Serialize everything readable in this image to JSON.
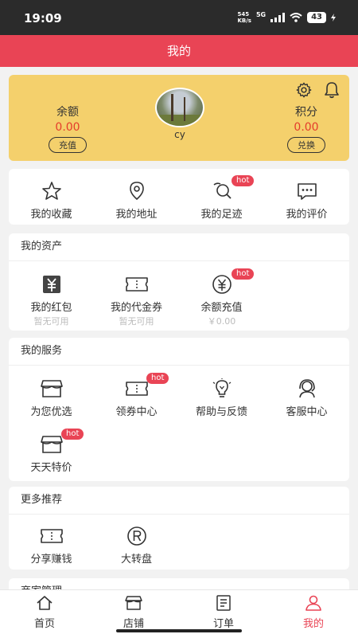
{
  "status": {
    "time": "19:09",
    "speed_top": "545",
    "speed_bottom": "KB/s",
    "network": "5G",
    "battery": "43"
  },
  "header": {
    "title": "我的"
  },
  "profile": {
    "balance_label": "余额",
    "balance_value": "0.00",
    "recharge_button": "充值",
    "points_label": "积分",
    "points_value": "0.00",
    "exchange_button": "兑换",
    "username": "cy"
  },
  "quick": [
    {
      "label": "我的收藏"
    },
    {
      "label": "我的地址"
    },
    {
      "label": "我的足迹",
      "badge": "hot"
    },
    {
      "label": "我的评价"
    }
  ],
  "assets": {
    "title": "我的资产",
    "items": [
      {
        "label": "我的红包",
        "sub": "暂无可用"
      },
      {
        "label": "我的代金券",
        "sub": "暂无可用"
      },
      {
        "label": "余额充值",
        "sub": "￥0.00",
        "badge": "hot"
      }
    ]
  },
  "services": {
    "title": "我的服务",
    "items": [
      {
        "label": "为您优选"
      },
      {
        "label": "领券中心",
        "badge": "hot"
      },
      {
        "label": "帮助与反馈"
      },
      {
        "label": "客服中心"
      },
      {
        "label": "天天特价",
        "badge": "hot"
      }
    ]
  },
  "more": {
    "title": "更多推荐",
    "items": [
      {
        "label": "分享赚钱"
      },
      {
        "label": "大转盘"
      }
    ]
  },
  "next_section": {
    "title": "商家管理"
  },
  "tabbar": [
    {
      "label": "首页"
    },
    {
      "label": "店铺"
    },
    {
      "label": "订单"
    },
    {
      "label": "我的",
      "active": true
    }
  ],
  "colors": {
    "accent": "#e94455",
    "profile_bg": "#f4d06c",
    "value_red": "#e43c2c"
  }
}
